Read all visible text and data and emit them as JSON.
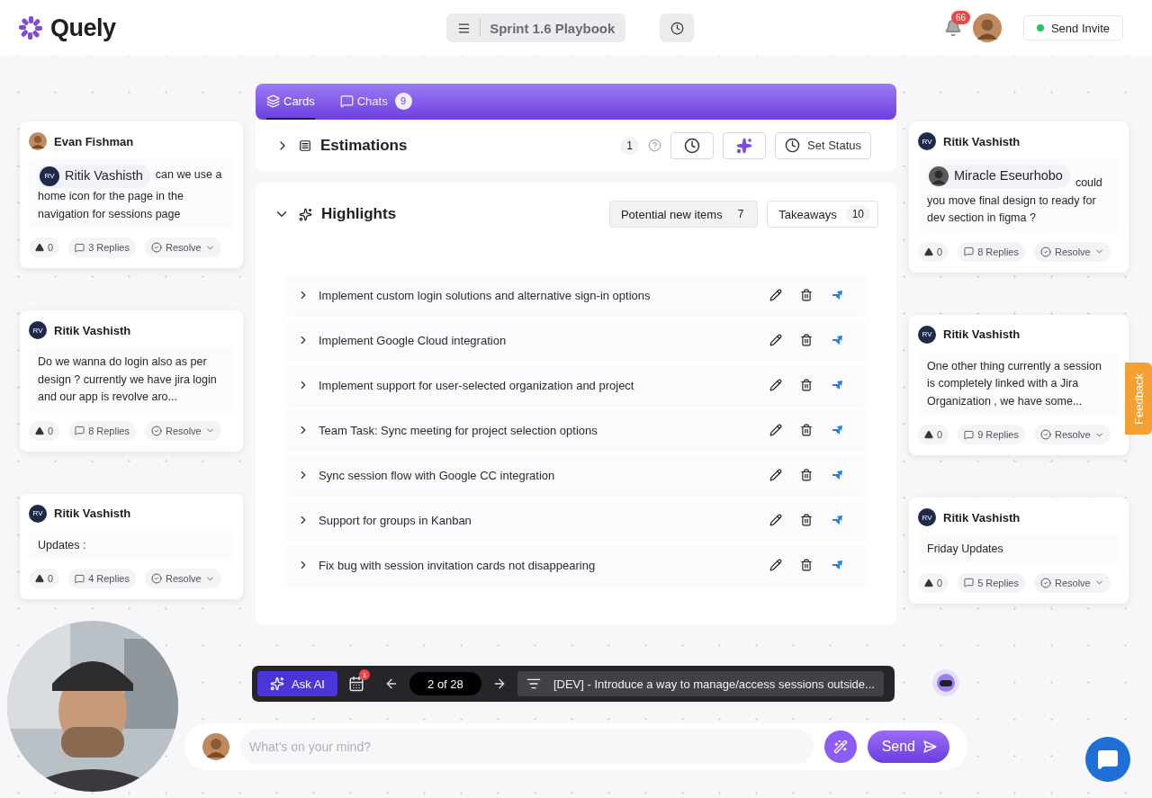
{
  "brand": {
    "name": "Quely"
  },
  "playbook": {
    "title": "Sprint 1.6 Playbook"
  },
  "notifications": {
    "count": "66"
  },
  "invite": {
    "label": "Send Invite",
    "online": true
  },
  "left_comments": [
    {
      "author": "Evan Fishman",
      "mention": {
        "name": "Ritik Vashisth",
        "initials": "RV"
      },
      "text": "can we use a home icon for the page in the navigation for sessions page",
      "votes": "0",
      "replies": "3 Replies",
      "resolve": "Resolve"
    },
    {
      "author": "Ritik Vashisth",
      "initials": "RV",
      "text": "Do we wanna do login also as per design ? currently we have jira login and our app is revolve aro...",
      "votes": "0",
      "replies": "8 Replies",
      "resolve": "Resolve"
    },
    {
      "author": "Ritik Vashisth",
      "initials": "RV",
      "text": "Updates :",
      "votes": "0",
      "replies": "4 Replies",
      "resolve": "Resolve"
    }
  ],
  "right_comments": [
    {
      "author": "Ritik Vashisth",
      "initials": "RV",
      "mention": {
        "name": "Miracle Eseurhobo"
      },
      "text": "could you move final design to ready for dev section in figma ?",
      "votes": "0",
      "replies": "8 Replies",
      "resolve": "Resolve"
    },
    {
      "author": "Ritik Vashisth",
      "initials": "RV",
      "text": "One other thing currently a session is completely linked with a Jira Organization , we have some...",
      "votes": "0",
      "replies": "9 Replies",
      "resolve": "Resolve"
    },
    {
      "author": "Ritik Vashisth",
      "initials": "RV",
      "text": "Friday Updates",
      "votes": "0",
      "replies": "5 Replies",
      "resolve": "Resolve"
    }
  ],
  "tabs": [
    {
      "label": "Cards",
      "selected": true
    },
    {
      "label": "Chats",
      "badge": "9",
      "selected": false
    }
  ],
  "estimations": {
    "title": "Estimations",
    "expanded": false,
    "count": "1",
    "status_button": "Set Status"
  },
  "highlights": {
    "title": "Highlights",
    "expanded": true,
    "filters": [
      {
        "label": "Potential new items",
        "count": "7",
        "selected": true
      },
      {
        "label": "Takeaways",
        "count": "10",
        "selected": false
      }
    ],
    "items": [
      {
        "title": "Implement custom login solutions and alternative sign-in options",
        "expanded": false
      },
      {
        "title": "Implement Google Cloud integration",
        "expanded": false
      },
      {
        "title": "Implement support for user-selected organization and project",
        "expanded": false
      },
      {
        "title": "Team Task: Sync meeting for project selection options",
        "expanded": false
      },
      {
        "title": "Sync session flow with Google CC integration",
        "expanded": false
      },
      {
        "title": "Support for groups in Kanban",
        "expanded": false
      },
      {
        "title": "Fix bug with session invitation cards not disappearing",
        "expanded": false
      }
    ]
  },
  "toolbar": {
    "ask_ai": "Ask AI",
    "calendar_badge": "1",
    "pager": "2 of 28",
    "current_item": "[DEV] - Introduce a way to manage/access sessions outside..."
  },
  "composer": {
    "placeholder": "What's on your mind?",
    "send": "Send"
  },
  "feedback": {
    "label": "Feedback"
  }
}
